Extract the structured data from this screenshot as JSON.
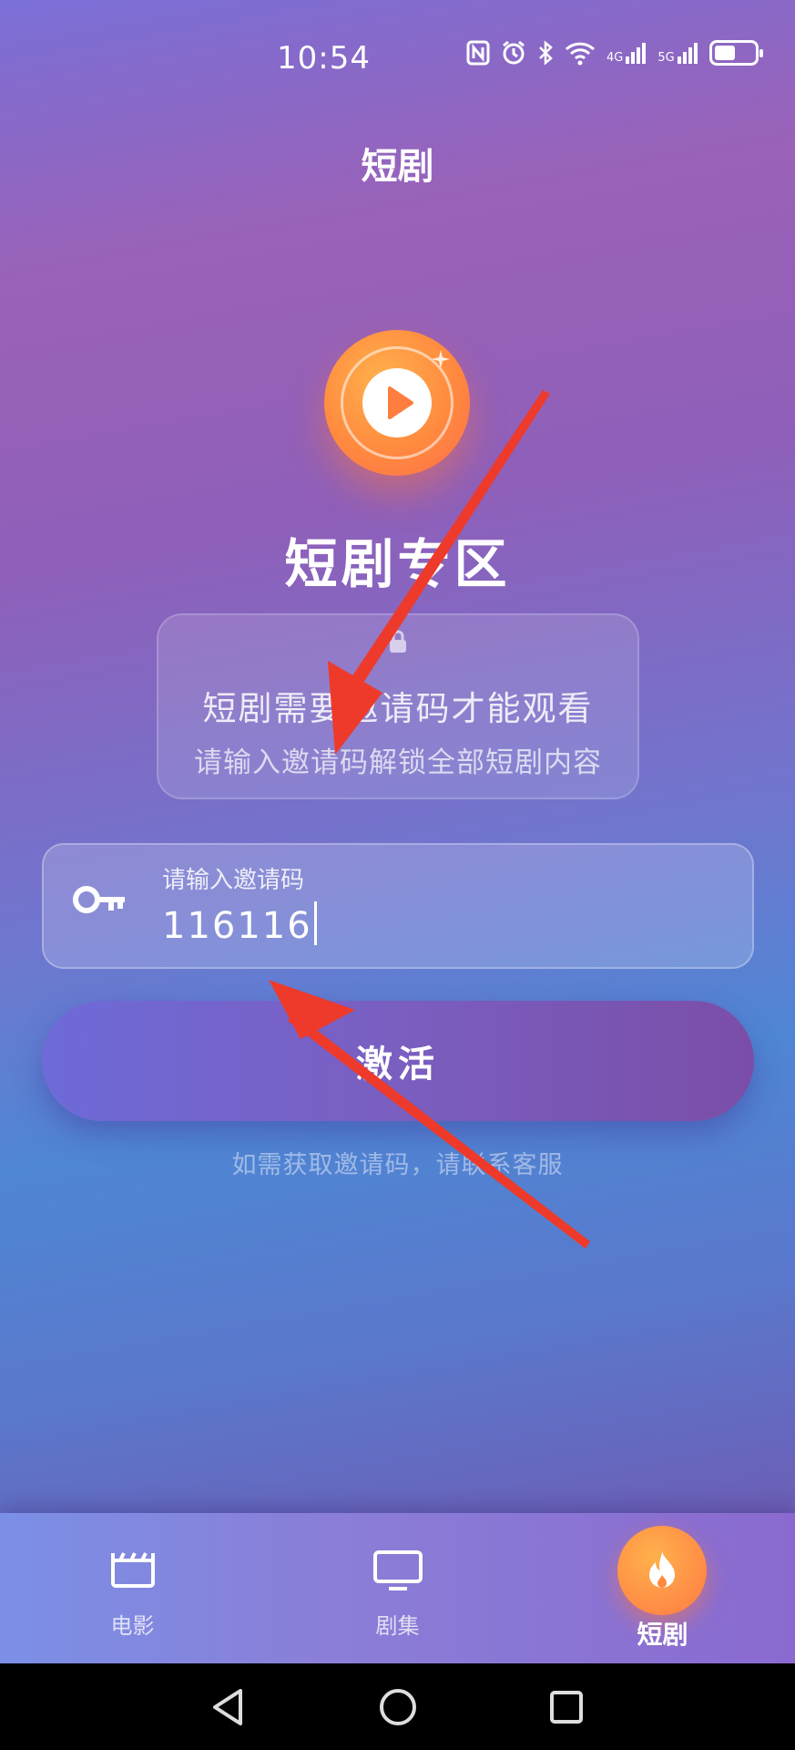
{
  "status_bar": {
    "time": "10:54",
    "icons": [
      "nfc-icon",
      "alarm-icon",
      "bluetooth-icon",
      "wifi-icon",
      "signal-4g-icon",
      "signal-5g-icon",
      "battery-icon"
    ],
    "network_4g": "4G",
    "network_5g": "5G"
  },
  "header": {
    "title": "短剧"
  },
  "hero": {
    "title": "短剧专区"
  },
  "info_card": {
    "line1": "短剧需要邀请码才能观看",
    "line2": "请输入邀请码解锁全部短剧内容"
  },
  "invite_input": {
    "label": "请输入邀请码",
    "value": "116116"
  },
  "activate_button": {
    "label": "激活"
  },
  "hint": "如需获取邀请码，请联系客服",
  "bottom_nav": {
    "items": [
      {
        "label": "电影",
        "icon": "clapperboard-icon",
        "active": false
      },
      {
        "label": "剧集",
        "icon": "tv-icon",
        "active": false
      },
      {
        "label": "短剧",
        "icon": "flame-icon",
        "active": true
      }
    ]
  },
  "colors": {
    "accent_orange": "#ff8a3f",
    "annotation_arrow": "#ee3a2a"
  }
}
